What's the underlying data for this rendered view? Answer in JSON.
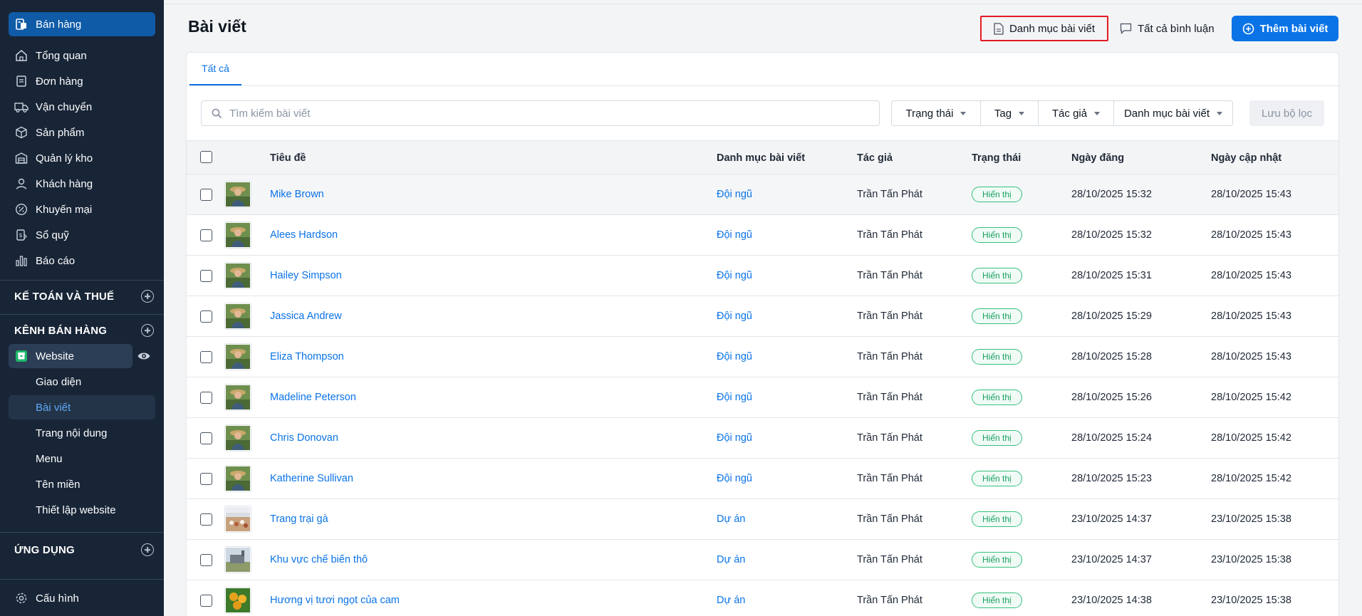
{
  "sidebar": {
    "items": [
      {
        "label": "Bán hàng",
        "icon": "store-icon",
        "active": true
      },
      {
        "label": "Tổng quan",
        "icon": "home-icon"
      },
      {
        "label": "Đơn hàng",
        "icon": "receipt-icon"
      },
      {
        "label": "Vận chuyển",
        "icon": "truck-icon"
      },
      {
        "label": "Sản phẩm",
        "icon": "box-icon"
      },
      {
        "label": "Quản lý kho",
        "icon": "warehouse-icon"
      },
      {
        "label": "Khách hàng",
        "icon": "user-icon"
      },
      {
        "label": "Khuyến mại",
        "icon": "discount-icon"
      },
      {
        "label": "Sổ quỹ",
        "icon": "cashbook-icon"
      },
      {
        "label": "Báo cáo",
        "icon": "bar-chart-icon"
      }
    ],
    "section_accounting": "KẾ TOÁN VÀ THUẾ",
    "section_channels": "KÊNH BÁN HÀNG",
    "website_label": "Website",
    "sub_items": [
      {
        "label": "Giao diện"
      },
      {
        "label": "Bài viết",
        "active": true
      },
      {
        "label": "Trang nội dung"
      },
      {
        "label": "Menu"
      },
      {
        "label": "Tên miền"
      },
      {
        "label": "Thiết lập website"
      }
    ],
    "section_apps": "ỨNG DỤNG",
    "settings_label": "Cấu hình"
  },
  "header": {
    "title": "Bài viết",
    "category_button": "Danh mục bài viết",
    "comments_button": "Tất cả bình luận",
    "add_button": "Thêm bài viết"
  },
  "tabs": [
    {
      "label": "Tất cả",
      "active": true
    }
  ],
  "search": {
    "placeholder": "Tìm kiếm bài viết",
    "value": ""
  },
  "filters": [
    "Trạng thái",
    "Tag",
    "Tác giả",
    "Danh mục bài viết"
  ],
  "save_filter_label": "Lưu bộ lọc",
  "table": {
    "columns": [
      "Tiêu đề",
      "Danh mục bài viết",
      "Tác giả",
      "Trạng thái",
      "Ngày đăng",
      "Ngày cập nhật"
    ],
    "rows": [
      {
        "title": "Mike Brown",
        "category": "Đội ngũ",
        "author": "Trần Tấn Phát",
        "status": "Hiển thị",
        "published": "28/10/2025 15:32",
        "updated": "28/10/2025 15:43",
        "thumb": "person"
      },
      {
        "title": "Alees Hardson",
        "category": "Đội ngũ",
        "author": "Trần Tấn Phát",
        "status": "Hiển thị",
        "published": "28/10/2025 15:32",
        "updated": "28/10/2025 15:43",
        "thumb": "person"
      },
      {
        "title": "Hailey Simpson",
        "category": "Đội ngũ",
        "author": "Trần Tấn Phát",
        "status": "Hiển thị",
        "published": "28/10/2025 15:31",
        "updated": "28/10/2025 15:43",
        "thumb": "person"
      },
      {
        "title": "Jassica Andrew",
        "category": "Đội ngũ",
        "author": "Trần Tấn Phát",
        "status": "Hiển thị",
        "published": "28/10/2025 15:29",
        "updated": "28/10/2025 15:43",
        "thumb": "person"
      },
      {
        "title": "Eliza Thompson",
        "category": "Đội ngũ",
        "author": "Trần Tấn Phát",
        "status": "Hiển thị",
        "published": "28/10/2025 15:28",
        "updated": "28/10/2025 15:43",
        "thumb": "person"
      },
      {
        "title": "Madeline Peterson",
        "category": "Đội ngũ",
        "author": "Trần Tấn Phát",
        "status": "Hiển thị",
        "published": "28/10/2025 15:26",
        "updated": "28/10/2025 15:42",
        "thumb": "person"
      },
      {
        "title": "Chris Donovan",
        "category": "Đội ngũ",
        "author": "Trần Tấn Phát",
        "status": "Hiển thị",
        "published": "28/10/2025 15:24",
        "updated": "28/10/2025 15:42",
        "thumb": "person"
      },
      {
        "title": "Katherine Sullivan",
        "category": "Đội ngũ",
        "author": "Trần Tấn Phát",
        "status": "Hiển thị",
        "published": "28/10/2025 15:23",
        "updated": "28/10/2025 15:42",
        "thumb": "person"
      },
      {
        "title": "Trang trại gà",
        "category": "Dự án",
        "author": "Trần Tấn Phát",
        "status": "Hiển thị",
        "published": "23/10/2025 14:37",
        "updated": "23/10/2025 15:38",
        "thumb": "farm"
      },
      {
        "title": "Khu vực chế biến thô",
        "category": "Dự án",
        "author": "Trần Tấn Phát",
        "status": "Hiển thị",
        "published": "23/10/2025 14:37",
        "updated": "23/10/2025 15:38",
        "thumb": "factory"
      },
      {
        "title": "Hương vị tươi ngọt của cam",
        "category": "Dự án",
        "author": "Trần Tấn Phát",
        "status": "Hiển thị",
        "published": "23/10/2025 14:38",
        "updated": "23/10/2025 15:38",
        "thumb": "fruit"
      }
    ]
  },
  "colors": {
    "sidebar_bg": "#182537",
    "active_nav": "#0f5ba7",
    "primary": "#0a73e6",
    "status_green": "#17a05f",
    "highlight_red": "#e31b23"
  }
}
